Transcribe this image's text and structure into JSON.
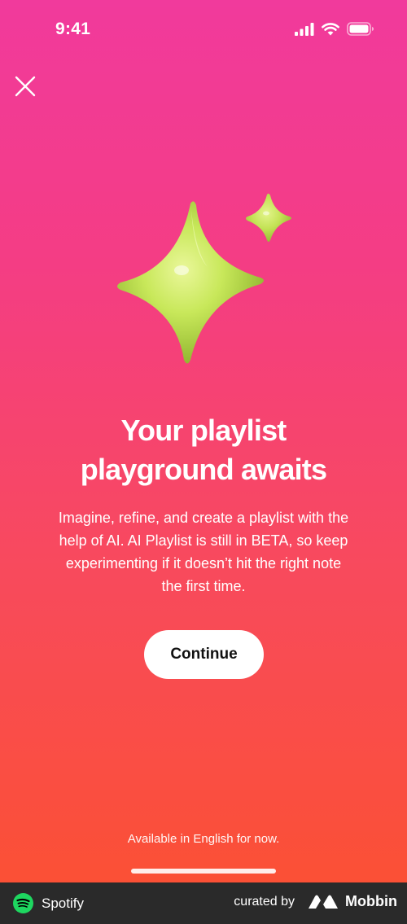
{
  "status_bar": {
    "time": "9:41"
  },
  "icons": {
    "close": "close-icon",
    "signal": "cellular-signal-icon",
    "wifi": "wifi-icon",
    "battery": "battery-icon",
    "hero": "sparkles-icon"
  },
  "content": {
    "title_line1": "Your playlist",
    "title_line2": "playground awaits",
    "body_line1": "Imagine, refine, and create a playlist with the",
    "body_line2": "help of AI. AI Playlist is still in BETA, so keep",
    "body_line3": "experimenting if it doesn’t hit the right note",
    "body_line4": "the first time.",
    "continue_label": "Continue",
    "footnote": "Available in English for now."
  },
  "attribution": {
    "app_name": "Spotify",
    "curated_by": "curated by",
    "brand": "Mobbin"
  },
  "colors": {
    "gradient_top": "#f13a9c",
    "gradient_bottom": "#fb5035",
    "sparkle": "#c8e85a",
    "button_bg": "#ffffff",
    "spotify_green": "#1ed760",
    "bar_bg": "#2a2a2a"
  }
}
